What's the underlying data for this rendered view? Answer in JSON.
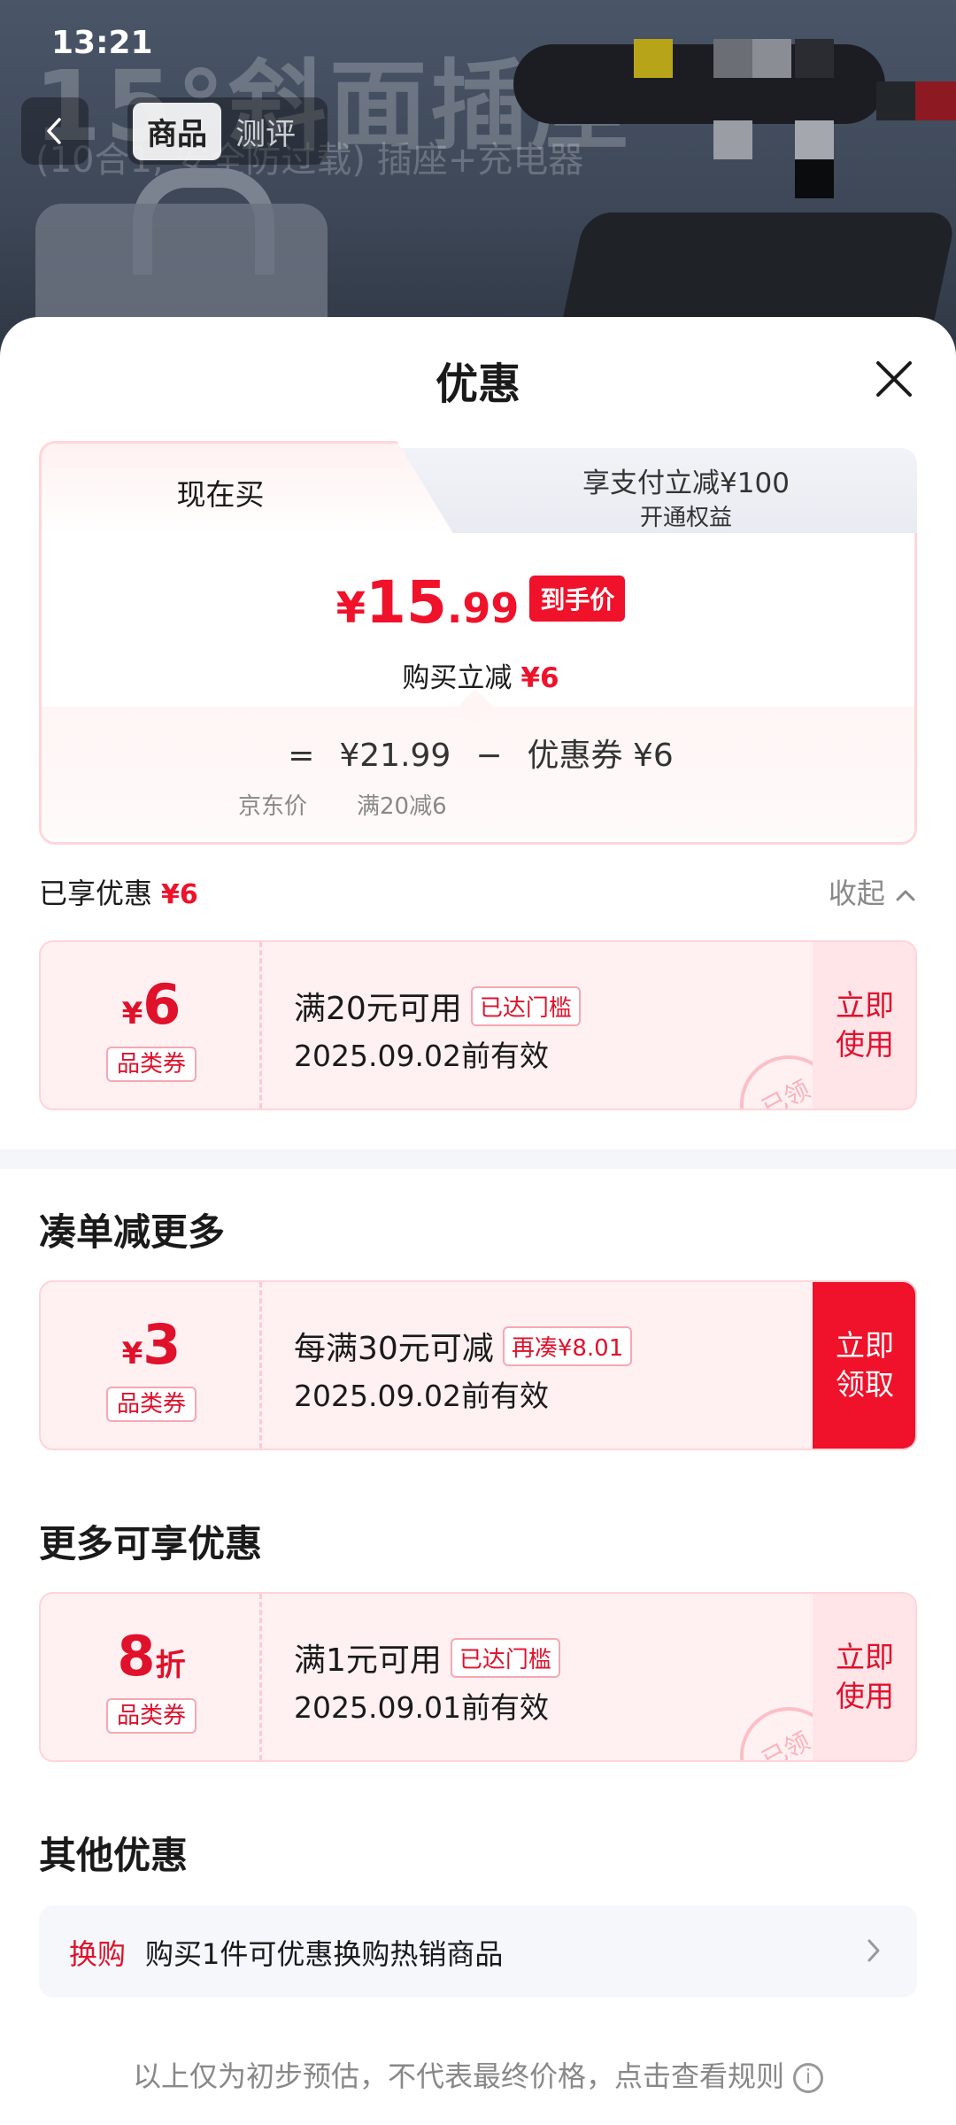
{
  "status": {
    "time": "13:21"
  },
  "background": {
    "title": "15°斜面插座",
    "subtitle": "(10合1, 安全防过载) 插座+充电器"
  },
  "nav": {
    "tabs": [
      {
        "label": "商品",
        "active": true
      },
      {
        "label": "测评",
        "active": false
      }
    ]
  },
  "sheet": {
    "title": "优惠",
    "price_tabs": {
      "now": "现在买",
      "pay": "享支付立减¥100",
      "pay_sub": "开通权益"
    },
    "final_price": {
      "yen": "¥",
      "int": "15",
      "dec": ".99",
      "tag": "到手价"
    },
    "cut_label": "购买立减",
    "cut_value": "¥6",
    "formula": {
      "eq": "=",
      "jd_price": "¥21.99",
      "minus": "−",
      "coupon": "优惠券 ¥6",
      "jd_label": "京东价",
      "coupon_label": "满20减6"
    },
    "enjoyed": {
      "label": "已享优惠",
      "value": "¥6",
      "collapse": "收起"
    },
    "coupons_enjoyed": [
      {
        "yen": "¥",
        "amount": "6",
        "type": "品类券",
        "condition": "满20元可用",
        "badge": "已达门槛",
        "valid": "2025.09.02前有效",
        "action": "立即\n使用",
        "stamp": "已领"
      }
    ],
    "more_section_title": "凑单减更多",
    "coupons_more": [
      {
        "yen": "¥",
        "amount": "3",
        "type": "品类券",
        "condition": "每满30元可减",
        "badge": "再凑¥8.01",
        "valid": "2025.09.02前有效",
        "action": "立即\n领取"
      }
    ],
    "extra_section_title": "更多可享优惠",
    "coupons_extra": [
      {
        "amount": "8",
        "unit": "折",
        "type": "品类券",
        "condition": "满1元可用",
        "badge": "已达门槛",
        "valid": "2025.09.01前有效",
        "action": "立即\n使用",
        "stamp": "已领"
      }
    ],
    "other_section_title": "其他优惠",
    "other": {
      "tag": "换购",
      "text": "购买1件可优惠换购热销商品"
    },
    "footer": "以上仅为初步预估，不代表最终价格，点击查看规则",
    "info_glyph": "i"
  },
  "colors": {
    "accent": "#f0112a",
    "coupon_bg": "#fff0f2",
    "muted": "#888888"
  }
}
